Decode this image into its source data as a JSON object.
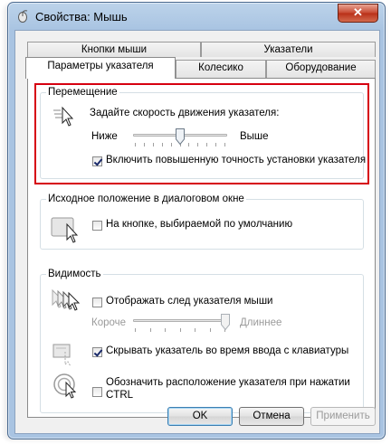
{
  "window": {
    "title": "Свойства: Мышь",
    "close_symbol": "✕"
  },
  "tabs": {
    "row_back": [
      "Кнопки мыши",
      "Указатели"
    ],
    "row_front": [
      "Параметры указателя",
      "Колесико",
      "Оборудование"
    ],
    "active": "Параметры указателя"
  },
  "motion": {
    "group_label": "Перемещение",
    "speed_prompt": "Задайте скорость движения указателя:",
    "slow_label": "Ниже",
    "fast_label": "Выше",
    "speed_level": 0.5,
    "enhance_precision_label": "Включить повышенную точность установки указателя",
    "enhance_precision_checked": true
  },
  "snap_to": {
    "group_label": "Исходное положение в диалоговом окне",
    "snap_label": "На кнопке, выбираемой по умолчанию",
    "snap_checked": false
  },
  "visibility": {
    "group_label": "Видимость",
    "trails_label": "Отображать след указателя мыши",
    "trails_checked": false,
    "trails_short": "Короче",
    "trails_long": "Длиннее",
    "trails_level": 1.0,
    "hide_label": "Скрывать указатель во время ввода с клавиатуры",
    "hide_checked": true,
    "ctrl_label_line1": "Обозначить расположение указателя при нажатии",
    "ctrl_label_line2": "CTRL",
    "ctrl_checked": false
  },
  "buttons": {
    "ok": "OK",
    "cancel": "Отмена",
    "apply": "Применить"
  },
  "colors": {
    "highlight_border": "#d60010",
    "title_bar": "#a9c4e2"
  }
}
